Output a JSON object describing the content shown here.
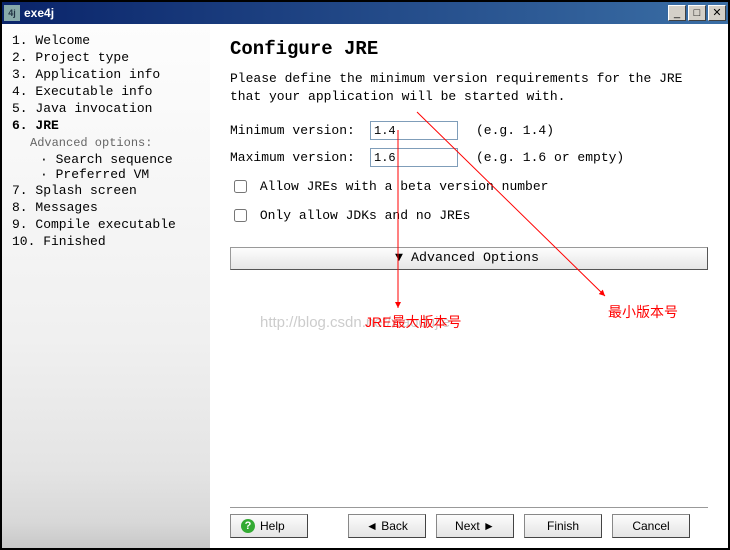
{
  "window": {
    "title": "exe4j"
  },
  "sidebar": {
    "steps": [
      "1. Welcome",
      "2. Project type",
      "3. Application info",
      "4. Executable info",
      "5. Java invocation",
      "6. JRE",
      "7. Splash screen",
      "8. Messages",
      "9. Compile executable",
      "10. Finished"
    ],
    "active_index": 5,
    "adv_header": "Advanced options:",
    "adv_items": [
      "· Search sequence",
      "· Preferred VM"
    ],
    "logo": "exe4j"
  },
  "main": {
    "heading": "Configure JRE",
    "description": "Please define the minimum version requirements for the JRE that your application will be started with.",
    "min_label": "Minimum version:",
    "min_value": "1.4",
    "min_hint": "(e.g. 1.4)",
    "max_label": "Maximum version:",
    "max_value": "1.6",
    "max_hint": "(e.g. 1.6 or empty)",
    "check_beta": "Allow JREs with a beta version number",
    "check_jdk": "Only allow JDKs and no JREs",
    "adv_button": "▼  Advanced Options"
  },
  "footer": {
    "help": "Help",
    "back": "◄  Back",
    "next": "Next  ►",
    "finish": "Finish",
    "cancel": "Cancel"
  },
  "annotations": {
    "watermark": "http://blog.csdn.net/xiaodujie",
    "label_max": "JRE最大版本号",
    "label_min": "最小版本号"
  }
}
